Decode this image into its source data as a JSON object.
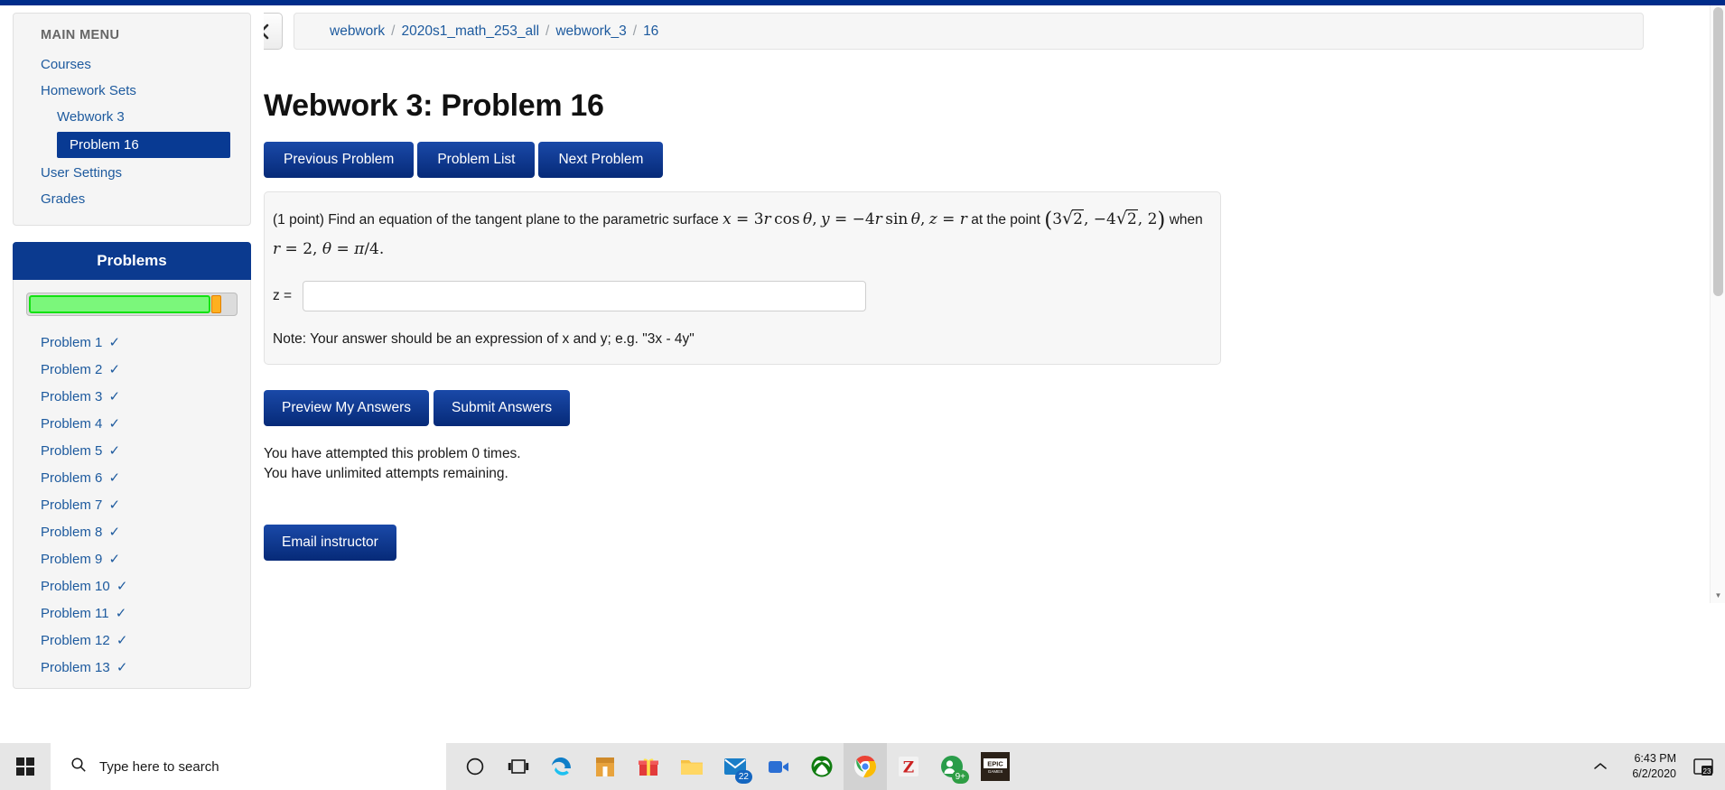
{
  "breadcrumb": {
    "back_icon": "chevron-left-icon",
    "items": [
      "webwork",
      "2020s1_math_253_all",
      "webwork_3",
      "16"
    ],
    "separator": "/"
  },
  "page": {
    "title": "Webwork 3: Problem 16"
  },
  "sidebar": {
    "menu_title": "MAIN MENU",
    "items": [
      {
        "label": "Courses",
        "level": 1,
        "active": false
      },
      {
        "label": "Homework Sets",
        "level": 1,
        "active": false
      },
      {
        "label": "Webwork 3",
        "level": 2,
        "active": false
      },
      {
        "label": "Problem 16",
        "level": 3,
        "active": true
      },
      {
        "label": "User Settings",
        "level": 1,
        "active": false
      },
      {
        "label": "Grades",
        "level": 1,
        "active": false
      }
    ],
    "problems_header": "Problems",
    "progress": {
      "correct_percent": 88,
      "pending_percent": 5,
      "remaining_percent": 7
    },
    "problems": [
      {
        "label": "Problem 1",
        "status": "✓"
      },
      {
        "label": "Problem 2",
        "status": "✓"
      },
      {
        "label": "Problem 3",
        "status": "✓"
      },
      {
        "label": "Problem 4",
        "status": "✓"
      },
      {
        "label": "Problem 5",
        "status": "✓"
      },
      {
        "label": "Problem 6",
        "status": "✓"
      },
      {
        "label": "Problem 7",
        "status": "✓"
      },
      {
        "label": "Problem 8",
        "status": "✓"
      },
      {
        "label": "Problem 9",
        "status": "✓"
      },
      {
        "label": "Problem 10",
        "status": "✓"
      },
      {
        "label": "Problem 11",
        "status": "✓"
      },
      {
        "label": "Problem 12",
        "status": "✓"
      },
      {
        "label": "Problem 13",
        "status": "✓"
      }
    ]
  },
  "nav_buttons": {
    "previous": "Previous Problem",
    "list": "Problem List",
    "next": "Next Problem"
  },
  "problem": {
    "points": "(1 point)",
    "text_1": "Find an equation of the tangent plane to the parametric surface",
    "eq_x": "x = 3r cos θ",
    "eq_y": "y = −4r sin θ",
    "eq_z": "z = r",
    "text_2": "at the point",
    "point": "(3√2, −4√2, 2)",
    "text_3": "when",
    "condition": "r = 2, θ = π/4.",
    "answer_label": "z =",
    "answer_value": "",
    "answer_placeholder": "",
    "note": "Note: Your answer should be an expression of x and y; e.g. \"3x - 4y\""
  },
  "actions": {
    "preview": "Preview My Answers",
    "submit": "Submit Answers",
    "email": "Email instructor"
  },
  "status": {
    "attempted": "You have attempted this problem 0 times.",
    "remaining": "You have unlimited attempts remaining."
  },
  "taskbar": {
    "search_placeholder": "Type here to search",
    "search_icon": "magnifier-icon",
    "start_icon": "windows-logo-icon",
    "items": [
      {
        "name": "cortana-icon",
        "label": "Cortana"
      },
      {
        "name": "task-view-icon",
        "label": "Task View"
      },
      {
        "name": "edge-icon",
        "label": "Microsoft Edge"
      },
      {
        "name": "microsoft-store-icon",
        "label": "Microsoft Store"
      },
      {
        "name": "gift-icon",
        "label": "Gift"
      },
      {
        "name": "file-explorer-icon",
        "label": "File Explorer"
      },
      {
        "name": "mail-icon",
        "label": "Mail",
        "badge": "22"
      },
      {
        "name": "video-chat-icon",
        "label": "Video"
      },
      {
        "name": "xbox-icon",
        "label": "Xbox"
      },
      {
        "name": "chrome-icon",
        "label": "Google Chrome",
        "active": true
      },
      {
        "name": "zotero-icon",
        "label": "Z"
      },
      {
        "name": "messenger-icon",
        "label": "Messenger",
        "badge": "9+"
      },
      {
        "name": "epic-games-icon",
        "label": "EPIC GAMES"
      }
    ],
    "tray_chevron": "show-hidden-icons",
    "clock_time": "6:43 PM",
    "clock_date": "6/2/2020",
    "notification_icon": "action-center-icon",
    "notification_badge": "23"
  },
  "colors": {
    "brand_blue": "#0b3a8f",
    "link_blue": "#1d5a9e",
    "progress_green": "#12e212",
    "progress_orange": "#ffb020"
  }
}
